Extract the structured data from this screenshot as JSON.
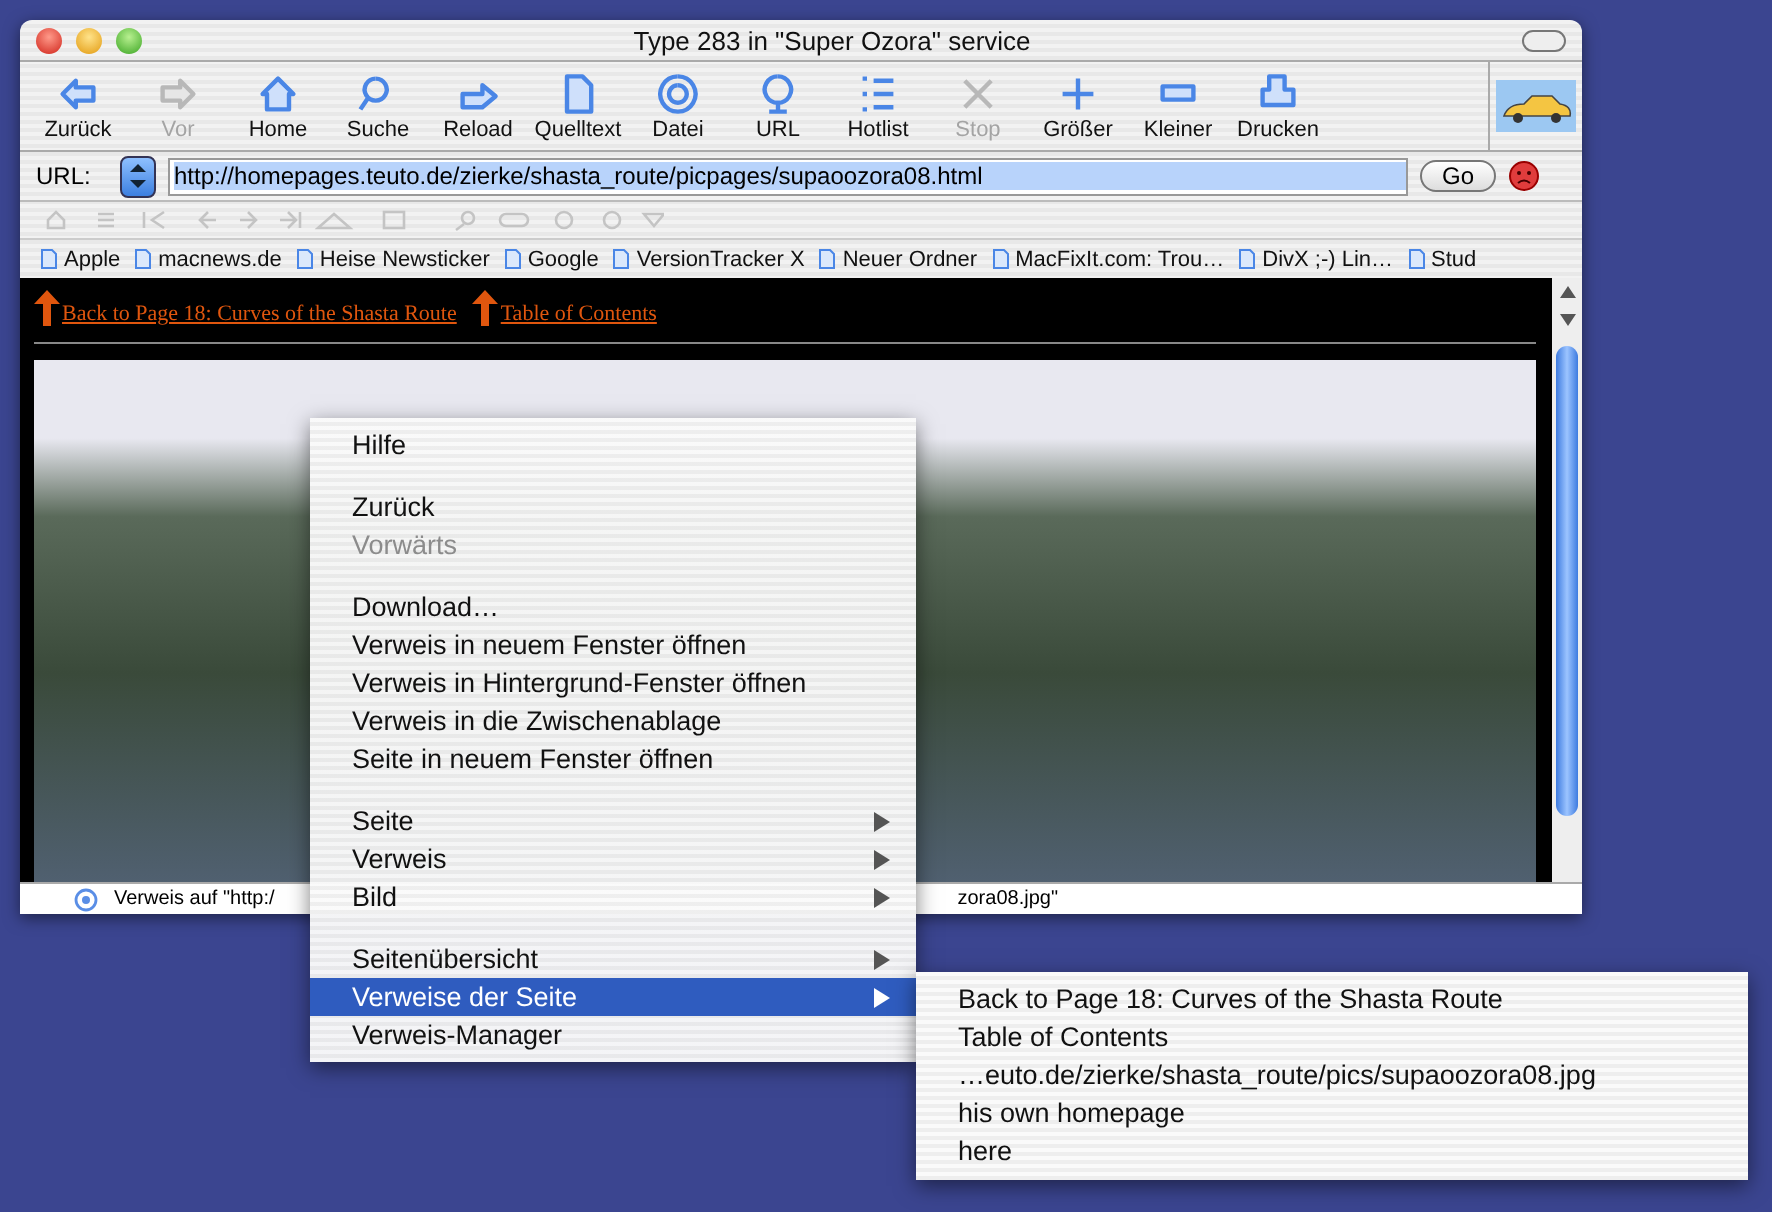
{
  "window": {
    "title": "Type 283 in \"Super Ozora\" service"
  },
  "toolbar": [
    {
      "label": "Zurück",
      "disabled": false
    },
    {
      "label": "Vor",
      "disabled": true
    },
    {
      "label": "Home",
      "disabled": false
    },
    {
      "label": "Suche",
      "disabled": false
    },
    {
      "label": "Reload",
      "disabled": false
    },
    {
      "label": "Quelltext",
      "disabled": false
    },
    {
      "label": "Datei",
      "disabled": false
    },
    {
      "label": "URL",
      "disabled": false
    },
    {
      "label": "Hotlist",
      "disabled": false
    },
    {
      "label": "Stop",
      "disabled": true
    },
    {
      "label": "Größer",
      "disabled": false
    },
    {
      "label": "Kleiner",
      "disabled": false
    },
    {
      "label": "Drucken",
      "disabled": false
    }
  ],
  "url_bar": {
    "label": "URL:",
    "value": "http://homepages.teuto.de/zierke/shasta_route/picpages/supaoozora08.html",
    "go": "Go"
  },
  "bookmarks": [
    "Apple",
    "macnews.de",
    "Heise Newsticker",
    "Google",
    "VersionTracker X",
    "Neuer Ordner",
    "MacFixIt.com: Trou…",
    "DivX ;-) Lin…",
    "Stud"
  ],
  "page": {
    "links": [
      "Back to Page 18: Curves of the Shasta Route",
      "Table of Contents"
    ]
  },
  "status_bar": {
    "text_left": "Verweis auf \"http:/",
    "text_right": "zora08.jpg\""
  },
  "context_menu": {
    "groups": [
      [
        {
          "label": "Hilfe",
          "disabled": false,
          "submenu": false,
          "selected": false
        }
      ],
      [
        {
          "label": "Zurück",
          "disabled": false,
          "submenu": false,
          "selected": false
        },
        {
          "label": "Vorwärts",
          "disabled": true,
          "submenu": false,
          "selected": false
        }
      ],
      [
        {
          "label": "Download…",
          "disabled": false,
          "submenu": false,
          "selected": false
        },
        {
          "label": "Verweis in neuem Fenster öffnen",
          "disabled": false,
          "submenu": false,
          "selected": false
        },
        {
          "label": "Verweis in Hintergrund-Fenster öffnen",
          "disabled": false,
          "submenu": false,
          "selected": false
        },
        {
          "label": "Verweis in die Zwischenablage",
          "disabled": false,
          "submenu": false,
          "selected": false
        },
        {
          "label": "Seite in neuem Fenster öffnen",
          "disabled": false,
          "submenu": false,
          "selected": false
        }
      ],
      [
        {
          "label": "Seite",
          "disabled": false,
          "submenu": true,
          "selected": false
        },
        {
          "label": "Verweis",
          "disabled": false,
          "submenu": true,
          "selected": false
        },
        {
          "label": "Bild",
          "disabled": false,
          "submenu": true,
          "selected": false
        }
      ],
      [
        {
          "label": "Seitenübersicht",
          "disabled": false,
          "submenu": true,
          "selected": false
        },
        {
          "label": "Verweise der Seite",
          "disabled": false,
          "submenu": true,
          "selected": true
        },
        {
          "label": "Verweis-Manager",
          "disabled": false,
          "submenu": false,
          "selected": false
        }
      ]
    ]
  },
  "submenu": [
    "Back to Page 18: Curves of the Shasta Route",
    "Table of Contents",
    "…euto.de/zierke/shasta_route/pics/supaoozora08.jpg",
    "his own homepage",
    "here"
  ]
}
